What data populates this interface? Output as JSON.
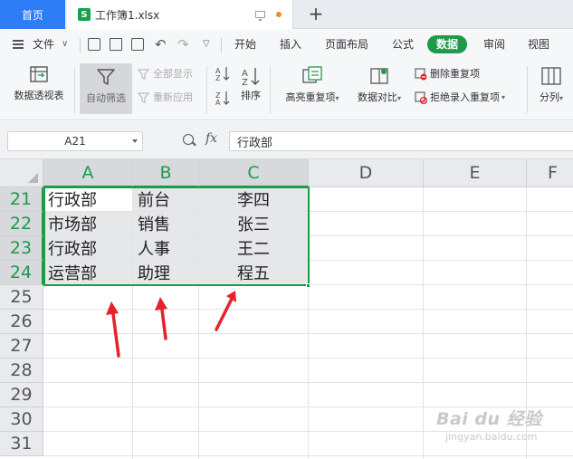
{
  "window": {
    "home_tab": "首页",
    "doc_tab": "工作簿1.xlsx",
    "doc_icon_letter": "S",
    "new_tab": "+"
  },
  "menu": {
    "file": "文件",
    "ribbon_tabs": [
      "开始",
      "插入",
      "页面布局",
      "公式",
      "数据",
      "审阅",
      "视图"
    ],
    "active_tab": "数据"
  },
  "ribbon": {
    "pivot": "数据透视表",
    "autofilter": "自动筛选",
    "show_all": "全部显示",
    "reapply": "重新应用",
    "sort": "排序",
    "highlight_dup": "高亮重复项",
    "compare": "数据对比",
    "remove_dup": "删除重复项",
    "reject_dup": "拒绝录入重复项",
    "split": "分列"
  },
  "formula_bar": {
    "name_box": "A21",
    "fx": "fx",
    "content": "行政部"
  },
  "grid": {
    "columns": [
      "A",
      "B",
      "C",
      "D",
      "E",
      "F"
    ],
    "rows": [
      "21",
      "22",
      "23",
      "24",
      "25",
      "26",
      "27",
      "28",
      "29",
      "30",
      "31"
    ],
    "data": [
      [
        "行政部",
        "前台",
        "李四"
      ],
      [
        "市场部",
        "销售",
        "张三"
      ],
      [
        "行政部",
        "人事",
        "王二"
      ],
      [
        "运营部",
        "助理",
        "程五"
      ]
    ]
  },
  "colors": {
    "accent_green": "#1e9a4a",
    "home_tab_blue": "#2f7df6",
    "arrow_red": "#e8202a"
  },
  "watermark": {
    "brand": "Bai du 经验",
    "url": "jingyan.baidu.com"
  }
}
